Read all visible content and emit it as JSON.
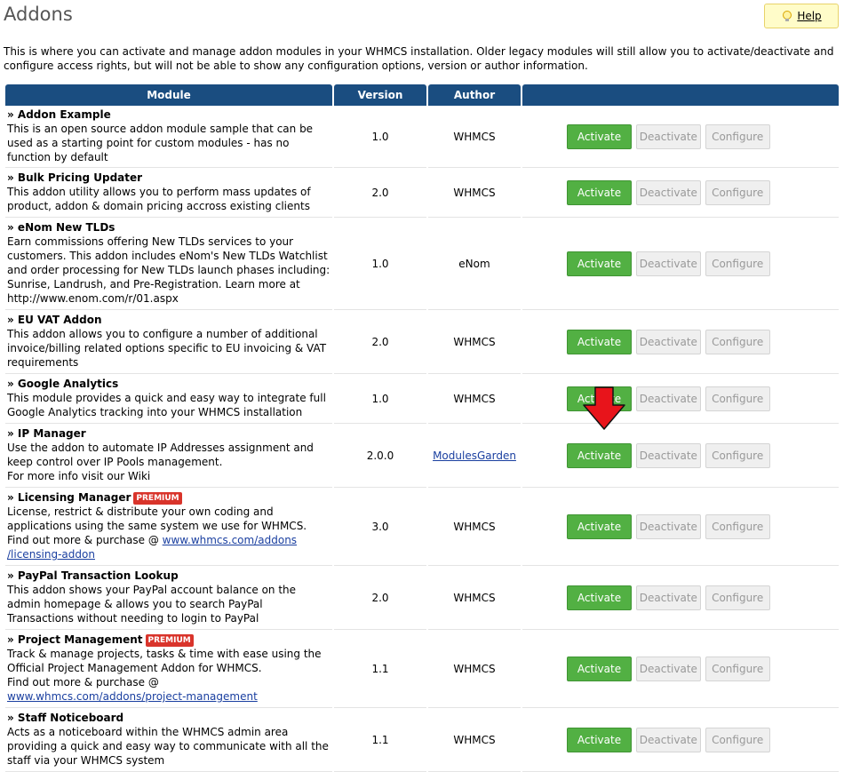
{
  "header": {
    "title": "Addons",
    "help_label": "Help"
  },
  "intro": "This is where you can activate and manage addon modules in your WHMCS installation. Older legacy modules will still allow you to activate/deactivate and configure access rights, but will not be able to show any configuration options, version or author information.",
  "table": {
    "columns": [
      "Module",
      "Version",
      "Author",
      ""
    ],
    "buttons": {
      "activate": "Activate",
      "deactivate": "Deactivate",
      "configure": "Configure"
    },
    "premium_label": "PREMIUM",
    "rows": [
      {
        "name": "» Addon Example",
        "premium": false,
        "desc": "This is an open source addon module sample that can be used as a starting point for custom modules - has no function by default",
        "version": "1.0",
        "author": "WHMCS"
      },
      {
        "name": "» Bulk Pricing Updater",
        "premium": false,
        "desc": "This addon utility allows you to perform mass updates of product, addon & domain pricing accross existing clients",
        "version": "2.0",
        "author": "WHMCS"
      },
      {
        "name": "» eNom New TLDs",
        "premium": false,
        "desc": "Earn commissions offering New TLDs services to your customers. This addon includes eNom's New TLDs Watchlist and order processing for New TLDs launch phases including: Sunrise, Landrush, and Pre-Registration. Learn more at http://www.enom.com/r/01.aspx",
        "version": "1.0",
        "author": "eNom"
      },
      {
        "name": "» EU VAT Addon",
        "premium": false,
        "desc": "This addon allows you to configure a number of additional invoice/billing related options specific to EU invoicing & VAT requirements",
        "version": "2.0",
        "author": "WHMCS"
      },
      {
        "name": "» Google Analytics",
        "premium": false,
        "desc": "This module provides a quick and easy way to integrate full Google Analytics tracking into your WHMCS installation",
        "version": "1.0",
        "author": "WHMCS"
      },
      {
        "name": "» IP Manager",
        "premium": false,
        "desc": "Use the addon to automate IP Addresses assignment and keep control over IP Pools management.",
        "desc2": "For more info visit our Wiki",
        "version": "2.0.0",
        "author": "ModulesGarden",
        "author_link": true
      },
      {
        "name": "» Licensing Manager",
        "premium": true,
        "desc": "License, restrict & distribute your own coding and applications using the same system we use for WHMCS.",
        "desc2": "Find out more & purchase @ ",
        "link": "www.whmcs.com/addons /licensing-addon",
        "version": "3.0",
        "author": "WHMCS"
      },
      {
        "name": "» PayPal Transaction Lookup",
        "premium": false,
        "desc": "This addon shows your PayPal account balance on the admin homepage & allows you to search PayPal Transactions without needing to login to PayPal",
        "version": "2.0",
        "author": "WHMCS"
      },
      {
        "name": "» Project Management",
        "premium": true,
        "desc": "Track & manage projects, tasks & time with ease using the Official Project Management Addon for WHMCS.",
        "desc2": "Find out more & purchase @ ",
        "link": "www.whmcs.com/addons/project-management",
        "version": "1.1",
        "author": "WHMCS"
      },
      {
        "name": "» Staff Noticeboard",
        "premium": false,
        "desc": "Acts as a noticeboard within the WHMCS admin area providing a quick and easy way to communicate with all the staff via your WHMCS system",
        "version": "1.1",
        "author": "WHMCS"
      }
    ]
  },
  "colors": {
    "header_bg": "#1a4d80",
    "activate": "#52b043",
    "premium": "#d9342b",
    "arrow": "#e8141b"
  }
}
